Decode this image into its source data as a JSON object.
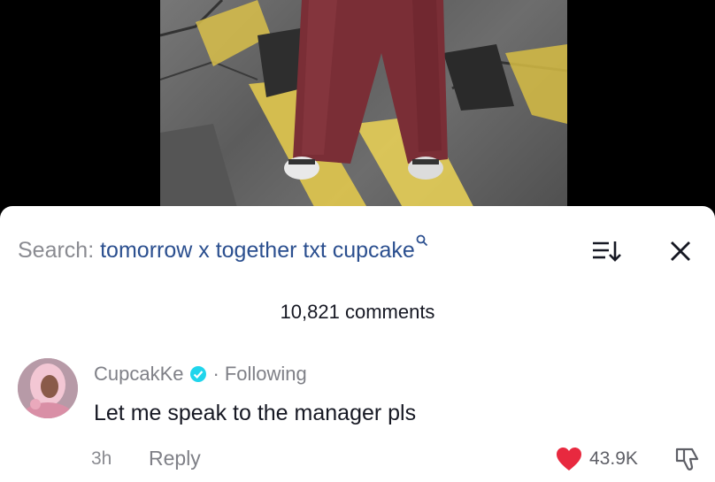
{
  "search": {
    "prefix": "Search: ",
    "term": "tomorrow x together txt cupcake",
    "term_icon": "search-icon"
  },
  "comments_header": {
    "count_label": "10,821 comments"
  },
  "comment": {
    "username": "CupcakKe",
    "verified_icon": "verified-badge-icon",
    "separator": "·",
    "follow_status": "Following",
    "text": "Let me speak to the manager pls",
    "time": "3h",
    "reply_label": "Reply",
    "like_count": "43.9K",
    "like_icon": "heart-icon",
    "dislike_icon": "thumbs-down-icon"
  },
  "colors": {
    "accent_blue": "#2b4f8f",
    "like_red": "#e8293f",
    "verified_blue": "#20d5ec",
    "text_dark": "#161823",
    "text_gray": "#8a8b91"
  }
}
